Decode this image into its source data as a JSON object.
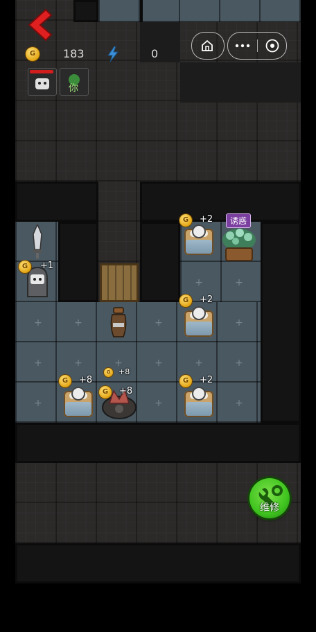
{
  "hud": {
    "coins": "183",
    "energy": "0",
    "player_tag": "你"
  },
  "rooms": {
    "left_gain": "+1",
    "bed_top_gain": "+2",
    "bed_mid_gain": "+2",
    "bed_bottom_right_gain": "+2",
    "bed_bottom_left_gain": "+8",
    "turret_small_gain": "+8",
    "turret_gain": "+8",
    "plant_badge": "诱惑"
  },
  "repair_button": {
    "label": "维修"
  },
  "icons": {
    "back": "back-chevron-icon",
    "coin": "coin-icon",
    "energy": "lightning-icon",
    "home": "home-icon",
    "more": "more-dots-icon",
    "close": "close-circle-icon",
    "repair": "wrench-icon"
  },
  "colors": {
    "back_arrow": "#e02020",
    "repair_green": "#3fc41f",
    "plant_badge_bg": "#7b3fa0",
    "coin_gold": "#e3a514",
    "energy_blue": "#3a8fd9"
  }
}
